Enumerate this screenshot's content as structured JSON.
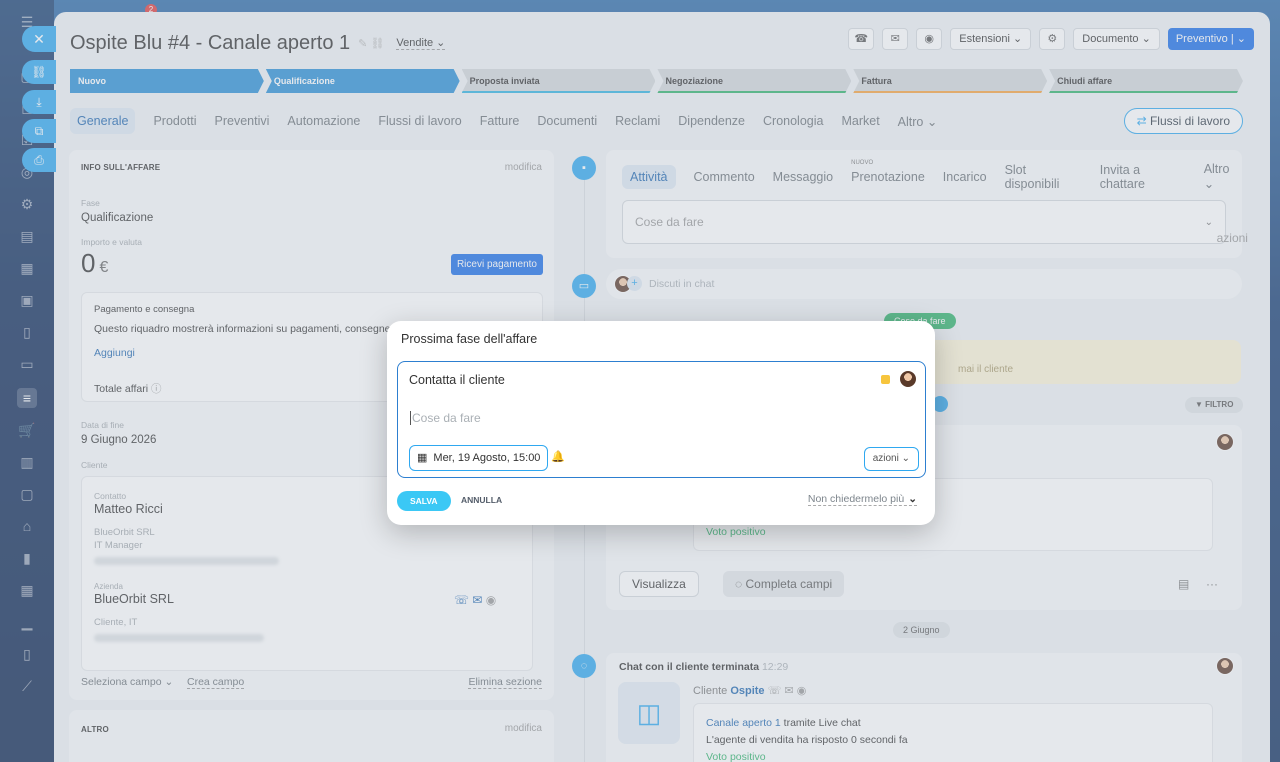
{
  "header": {
    "title": "Ospite Blu #4 - Canale aperto 1",
    "category": "Vendite",
    "notification_count": "2",
    "tools": [
      "Estensioni",
      "Documento"
    ],
    "primary": "Preventivo"
  },
  "stages": [
    "Nuovo",
    "Qualificazione",
    "Proposta inviata",
    "Negoziazione",
    "Fattura",
    "Chiudi affare"
  ],
  "tabs": [
    "Generale",
    "Prodotti",
    "Preventivi",
    "Automazione",
    "Flussi di lavoro",
    "Fatture",
    "Documenti",
    "Reclami",
    "Dipendenze",
    "Cronologia",
    "Market",
    "Altro"
  ],
  "flussi_button": "Flussi di lavoro",
  "deal_info": {
    "section_title": "INFO SULL'AFFARE",
    "edit": "modifica",
    "stage_label": "Fase",
    "stage_value": "Qualificazione",
    "amount_label": "Importo e valuta",
    "amount": "0",
    "currency": "€",
    "receive_payment": "Ricevi pagamento",
    "payment_title": "Pagamento e consegna",
    "payment_text": "Questo riquadro mostrerà informazioni su pagamenti, consegne",
    "add_link": "Aggiungi",
    "total_label": "Totale affari",
    "end_date_label": "Data di fine",
    "end_date": "9 Giugno 2026",
    "client_label": "Cliente",
    "contact_label": "Contatto",
    "contact_name": "Matteo Ricci",
    "contact_company": "BlueOrbit SRL",
    "contact_role": "IT Manager",
    "company_label": "Azienda",
    "company_name": "BlueOrbit SRL",
    "company_type": "Cliente, IT",
    "select_field": "Seleziona campo",
    "create_field": "Crea campo",
    "delete_section": "Elimina sezione"
  },
  "other_section": {
    "title": "ALTRO",
    "edit": "modifica"
  },
  "activity": {
    "tabs": [
      "Attività",
      "Commento",
      "Messaggio",
      "Prenotazione",
      "Incarico",
      "Slot disponibili",
      "Invita a chattare",
      "Altro"
    ],
    "new_badge": "NUOVO",
    "todo_placeholder": "Cose da fare",
    "azioni": "azioni"
  },
  "chat": {
    "placeholder": "Discuti in chat"
  },
  "timeline": {
    "todo_pill": "Cose da fare",
    "yellow_text": "mai il cliente",
    "filter": "FILTRO",
    "positive_vote": "Voto positivo",
    "view_button": "Visualizza",
    "complete_button": "Completa campi",
    "date_pill": "2 Giugno",
    "chat_end_title": "Chat con il cliente terminata",
    "chat_end_time": "12:29",
    "client_label": "Cliente",
    "client_name": "Ospite",
    "channel_link": "Canale aperto 1",
    "channel_rest": "tramite Live chat",
    "agent_text": "L'agente di vendita ha risposto 0 secondi fa",
    "positive_vote_2": "Voto positivo"
  },
  "popup": {
    "title": "Prossima fase dell'affare",
    "todo_title": "Contatta il cliente",
    "placeholder": "Cose da fare",
    "date": "Mer, 19 Agosto, 15:00",
    "azioni": "azioni",
    "save": "SALVA",
    "cancel": "ANNULLA",
    "never_ask": "Non chiedermelo più"
  },
  "colors": {
    "accent": "#2fa8f0",
    "primary": "#1a6ee8",
    "stage_active": "#2a8fd6",
    "success": "#2fb36a",
    "todo_flag": "#f7c53d"
  }
}
